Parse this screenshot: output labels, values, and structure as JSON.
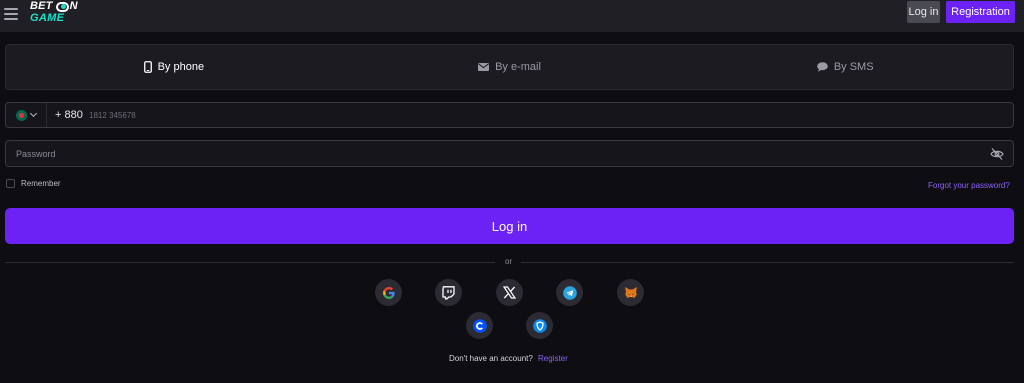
{
  "header": {
    "logo_top": "BET",
    "logo_on": "N",
    "logo_bottom": "GAME",
    "login_label": "Log in",
    "registration_label": "Registration"
  },
  "tabs": [
    {
      "label": "By phone",
      "icon": "phone-icon",
      "active": true
    },
    {
      "label": "By e-mail",
      "icon": "mail-icon",
      "active": false
    },
    {
      "label": "By SMS",
      "icon": "chat-bubble-icon",
      "active": false
    }
  ],
  "phone": {
    "country_flag": "bangladesh-flag-icon",
    "code": "+ 880",
    "placeholder": "1812 345678"
  },
  "password": {
    "placeholder": "Password",
    "toggle_icon": "eye-off-icon"
  },
  "remember_label": "Remember",
  "forgot_label": "Forgot your password?",
  "login_button_label": "Log in",
  "divider_text": "or",
  "social_icons": [
    "google-icon",
    "twitch-icon",
    "x-icon",
    "telegram-icon",
    "metamask-icon",
    "coinbase-icon",
    "trust-wallet-icon"
  ],
  "footer": {
    "no_account_text": "Don't have an account?",
    "register_label": "Register"
  },
  "colors": {
    "accent": "#6c22f4",
    "link": "#8e61ff",
    "logo_accent": "#16e0c8",
    "background": "#0e0d12"
  }
}
